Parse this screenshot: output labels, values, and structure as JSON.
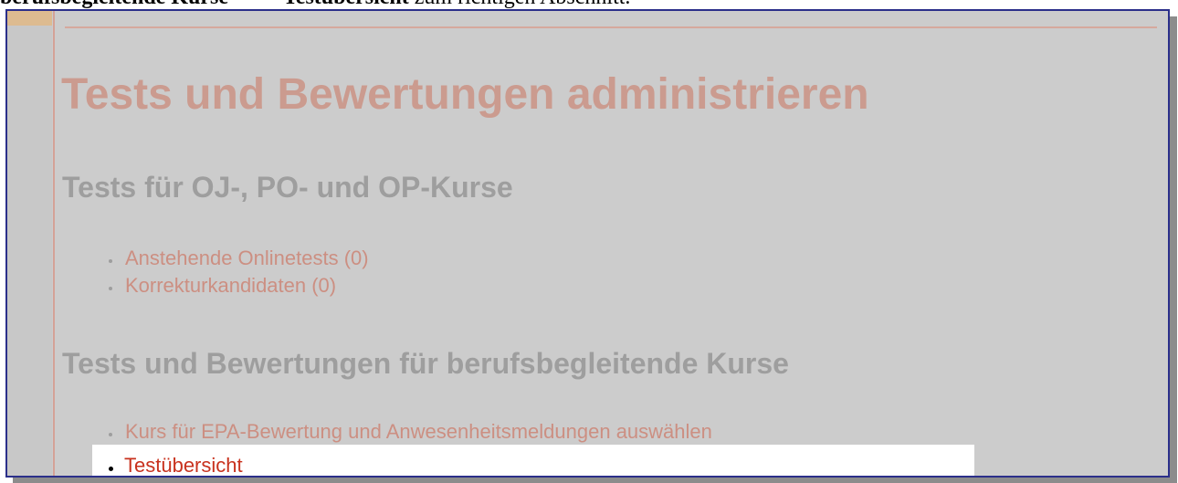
{
  "caption": {
    "part1": "berufsbegleitende Kurse",
    "part2": "Testübersicht",
    "part3": " zum richtigen Abschnitt."
  },
  "page": {
    "title": "Tests und Bewertungen administrieren",
    "section1": {
      "heading": "Tests für OJ-, PO- und OP-Kurse",
      "links": [
        "Anstehende Onlinetests (0)",
        "Korrekturkandidaten (0)"
      ]
    },
    "section2": {
      "heading": "Tests und Bewertungen für berufsbegleitende Kurse",
      "links": [
        "Kurs für EPA-Bewertung und Anwesenheitsmeldungen auswählen",
        "Testübersicht"
      ]
    }
  },
  "colors": {
    "title": "#cb9b8f",
    "heading": "#9e9e9e",
    "link": "#cc8f82",
    "active_link": "#c8321e",
    "overlay": "#cccccc",
    "frame_border": "#2b2f8a"
  }
}
